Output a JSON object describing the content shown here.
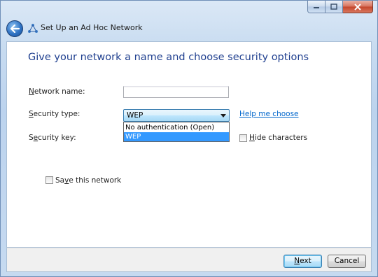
{
  "window": {
    "title": "Set Up an Ad Hoc Network",
    "caption_buttons": [
      "minimize",
      "maximize",
      "close"
    ]
  },
  "page": {
    "heading": "Give your network a name and choose security options"
  },
  "form": {
    "network_name": {
      "label_prefix": "",
      "label_access_key": "N",
      "label_rest": "etwork name:",
      "value": ""
    },
    "security_type": {
      "label_access_key": "S",
      "label_rest": "ecurity type:",
      "selected": "WEP",
      "options": [
        "No authentication (Open)",
        "WEP"
      ],
      "help_link": "Help me choose"
    },
    "security_key": {
      "label_prefix": "S",
      "label_access_key": "e",
      "label_rest": "curity key:",
      "hide_characters": {
        "label_access_key": "H",
        "label_rest": "ide characters",
        "checked": false
      }
    },
    "save_network": {
      "label_prefix": "Sa",
      "label_access_key": "v",
      "label_rest": "e this network",
      "checked": false
    }
  },
  "footer": {
    "next_access_key": "N",
    "next_rest": "ext",
    "cancel_label": "Cancel"
  },
  "colors": {
    "heading": "#1f3f8f",
    "link": "#0066cc",
    "selection": "#3399ff"
  }
}
